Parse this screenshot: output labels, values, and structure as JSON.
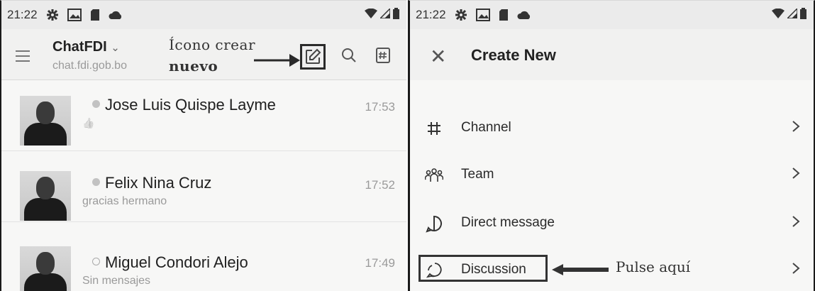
{
  "status_bar": {
    "time": "21:22"
  },
  "left_screen": {
    "workspace_name": "ChatFDI",
    "workspace_url": "chat.fdi.gob.bo",
    "annotation": {
      "line1": "Ícono crear",
      "line2": "nuevo"
    },
    "chats": [
      {
        "name": "Jose Luis Quispe Layme",
        "time": "17:53",
        "preview": "👍",
        "status": "away"
      },
      {
        "name": "Felix Nina Cruz",
        "time": "17:52",
        "preview": "gracias hermano",
        "status": "away"
      },
      {
        "name": "Miguel Condori Alejo",
        "time": "17:49",
        "preview": "Sin mensajes",
        "status": "offline"
      }
    ]
  },
  "right_screen": {
    "title": "Create New",
    "items": [
      {
        "label": "Channel",
        "icon": "hash-icon"
      },
      {
        "label": "Team",
        "icon": "team-icon"
      },
      {
        "label": "Direct message",
        "icon": "direct-message-icon"
      },
      {
        "label": "Discussion",
        "icon": "discussion-icon"
      }
    ],
    "annotation": "Pulse aquí"
  },
  "colors": {
    "background": "#f7f7f6",
    "status_bar": "#ebebeb",
    "text": "#2b2b2b",
    "muted": "#9a9a9a",
    "frame": "#1a1a1a"
  }
}
